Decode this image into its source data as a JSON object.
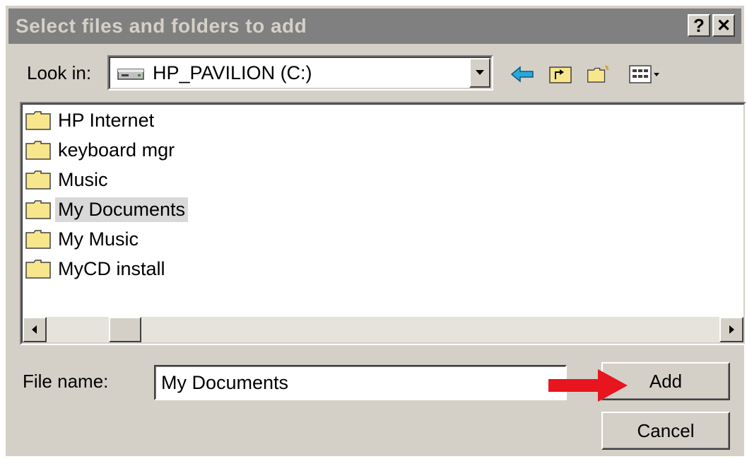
{
  "window": {
    "title": "Select files and folders to add",
    "help_label": "?",
    "close_label": "✕"
  },
  "lookin": {
    "label": "Look in:",
    "value": "HP_PAVILION (C:)",
    "icon": "hard-drive-icon"
  },
  "toolbar": {
    "icons": [
      "back-arrow-icon",
      "up-one-level-icon",
      "new-folder-icon",
      "view-menu-icon"
    ]
  },
  "file_list": {
    "items": [
      {
        "label": "HP Internet",
        "icon": "folder-icon",
        "selected": false
      },
      {
        "label": "keyboard mgr",
        "icon": "folder-icon",
        "selected": false
      },
      {
        "label": "Music",
        "icon": "folder-icon",
        "selected": false
      },
      {
        "label": "My Documents",
        "icon": "folder-icon",
        "selected": true
      },
      {
        "label": "My Music",
        "icon": "folder-icon",
        "selected": false
      },
      {
        "label": "MyCD install",
        "icon": "folder-icon",
        "selected": false
      }
    ]
  },
  "filename": {
    "label": "File name:",
    "value": "My Documents"
  },
  "buttons": {
    "add_label": "Add",
    "cancel_label": "Cancel"
  },
  "colors": {
    "dialog_bg": "#d4d0c8",
    "titlebar_bg": "#808080",
    "folder_yellow": "#f7e68c",
    "arrow_red": "#e8141e"
  }
}
